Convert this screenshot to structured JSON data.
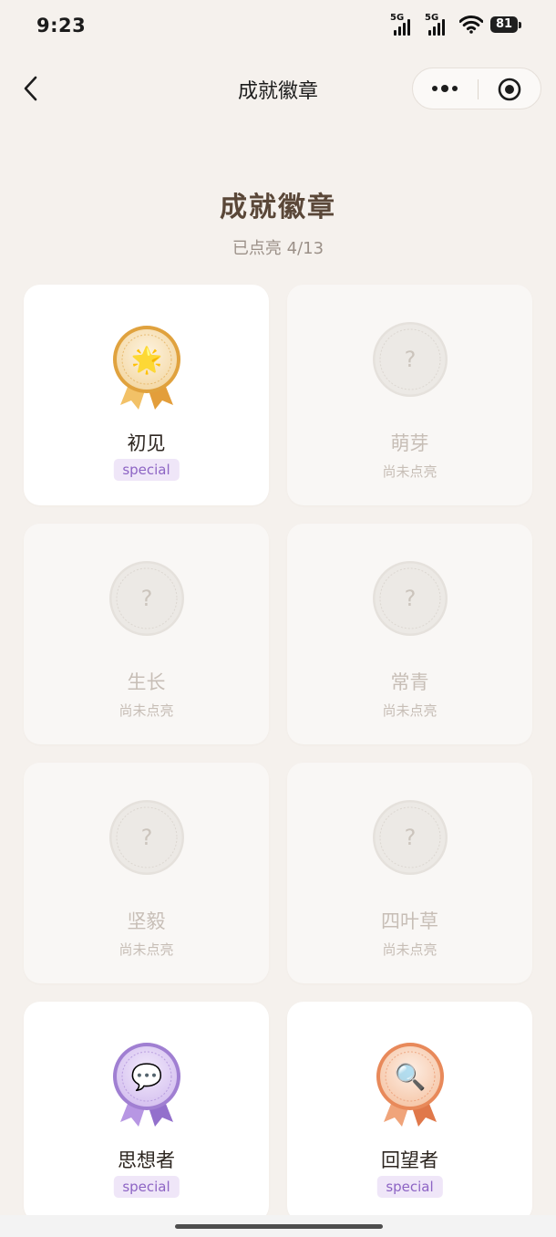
{
  "status_bar": {
    "time": "9:23",
    "network_1": "5G",
    "network_2": "5G",
    "battery": "81"
  },
  "nav": {
    "title": "成就徽章",
    "back_icon": "chevron-left-icon",
    "more_icon": "more-dots-icon",
    "close_icon": "target-circle-icon"
  },
  "header": {
    "title": "成就徽章",
    "progress": "已点亮 4/13"
  },
  "badges": [
    {
      "name": "初见",
      "tag": "special",
      "status": "",
      "unlocked": true,
      "emoji": "🌟",
      "icon": "star-medal-icon",
      "theme": "gold"
    },
    {
      "name": "萌芽",
      "tag": "",
      "status": "尚未点亮",
      "unlocked": false,
      "emoji": "?",
      "icon": "locked-badge-icon",
      "theme": "locked"
    },
    {
      "name": "生长",
      "tag": "",
      "status": "尚未点亮",
      "unlocked": false,
      "emoji": "?",
      "icon": "locked-badge-icon",
      "theme": "locked"
    },
    {
      "name": "常青",
      "tag": "",
      "status": "尚未点亮",
      "unlocked": false,
      "emoji": "?",
      "icon": "locked-badge-icon",
      "theme": "locked"
    },
    {
      "name": "坚毅",
      "tag": "",
      "status": "尚未点亮",
      "unlocked": false,
      "emoji": "?",
      "icon": "locked-badge-icon",
      "theme": "locked"
    },
    {
      "name": "四叶草",
      "tag": "",
      "status": "尚未点亮",
      "unlocked": false,
      "emoji": "?",
      "icon": "locked-badge-icon",
      "theme": "locked"
    },
    {
      "name": "思想者",
      "tag": "special",
      "status": "",
      "unlocked": true,
      "emoji": "💬",
      "icon": "speech-bubble-medal-icon",
      "theme": "purple"
    },
    {
      "name": "回望者",
      "tag": "special",
      "status": "",
      "unlocked": true,
      "emoji": "🔍",
      "icon": "magnifier-medal-icon",
      "theme": "orange"
    }
  ],
  "colors": {
    "background": "#f5f1ed",
    "card_unlocked": "#ffffff",
    "card_locked": "#f9f7f5",
    "heading": "#5a4738",
    "tag_text": "#8d64c4",
    "tag_bg": "#efe6f8",
    "locked_text": "#c7beb6",
    "gold": "#e8a94a",
    "purple": "#a07fd2",
    "orange": "#e8895a"
  }
}
